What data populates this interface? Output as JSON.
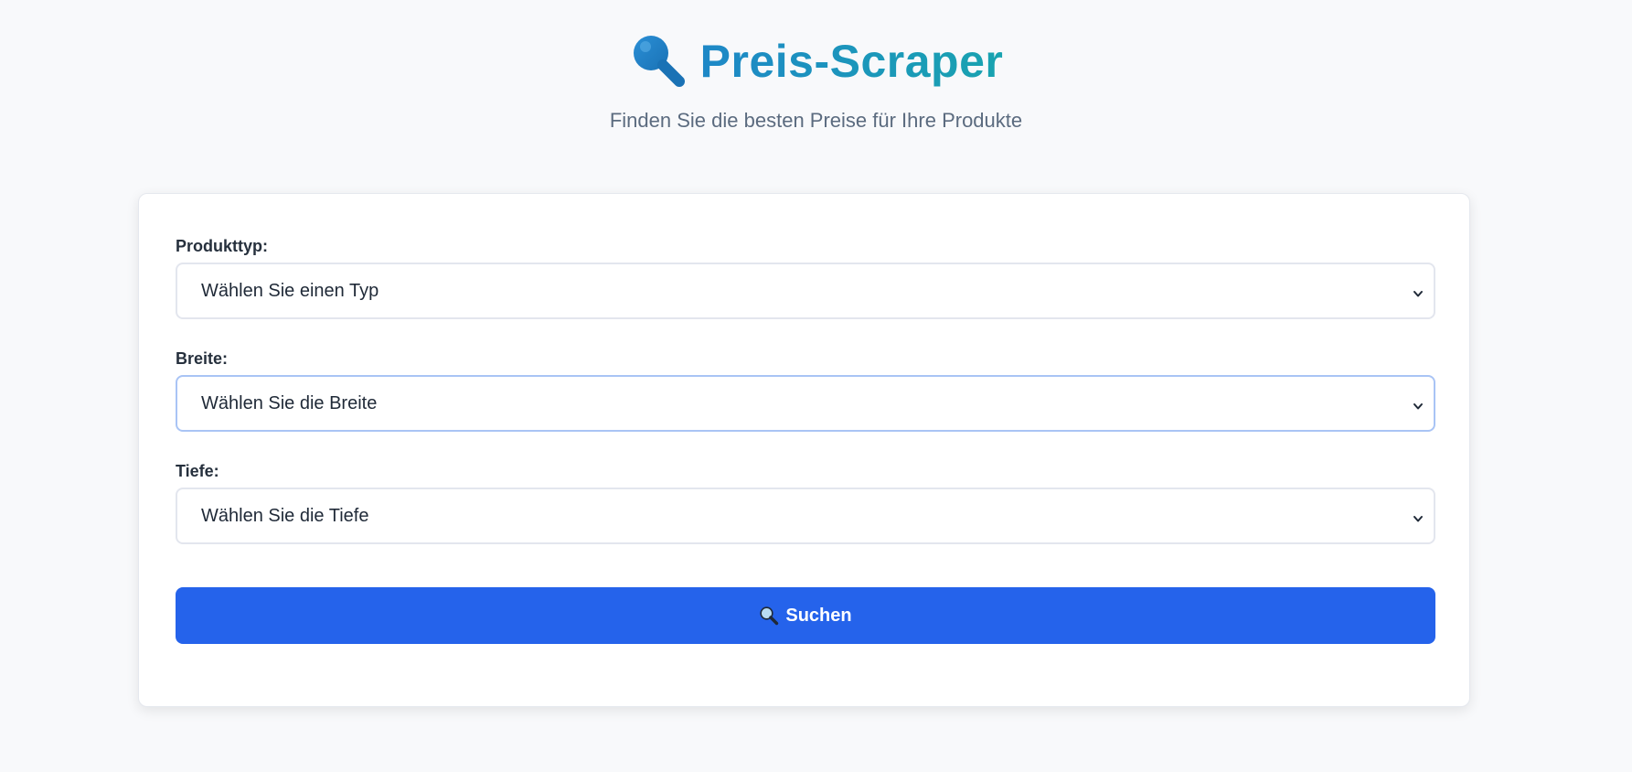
{
  "header": {
    "title": "Preis-Scraper",
    "subtitle": "Finden Sie die besten Preise für Ihre Produkte",
    "title_icon": "magnifier-icon"
  },
  "form": {
    "fields": [
      {
        "label": "Produkttyp:",
        "selected": "Wählen Sie einen Typ",
        "focused": false
      },
      {
        "label": "Breite:",
        "selected": "Wählen Sie die Breite",
        "focused": true
      },
      {
        "label": "Tiefe:",
        "selected": "Wählen Sie die Tiefe",
        "focused": false
      }
    ],
    "submit_label": "Suchen",
    "submit_icon": "magnifier-icon"
  },
  "colors": {
    "background": "#f8f9fb",
    "title_gradient_start": "#1e88c7",
    "title_gradient_end": "#19a3b0",
    "button": "#2563eb",
    "focus_border": "#a9c4f5"
  }
}
